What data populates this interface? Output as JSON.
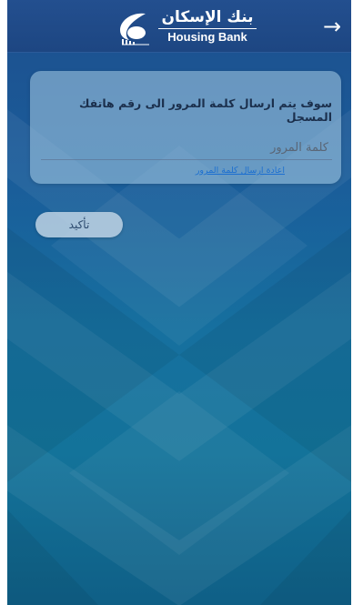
{
  "header": {
    "logo_arabic": "بنك الإسكان",
    "logo_english": "Housing Bank",
    "back_icon": "arrow-right-icon"
  },
  "card": {
    "message": "سوف يتم ارسال كلمة المرور الى رقم هاتفك المسجل",
    "password_placeholder": "كلمة المرور",
    "resend_link": "اعادة ارسال كلمة المرور"
  },
  "actions": {
    "confirm_label": "تأكيد"
  },
  "colors": {
    "header_bg": "#1d4682",
    "background_top": "#1d4f8e",
    "background_bottom": "#0f5f86",
    "link": "#1c6fd0"
  }
}
